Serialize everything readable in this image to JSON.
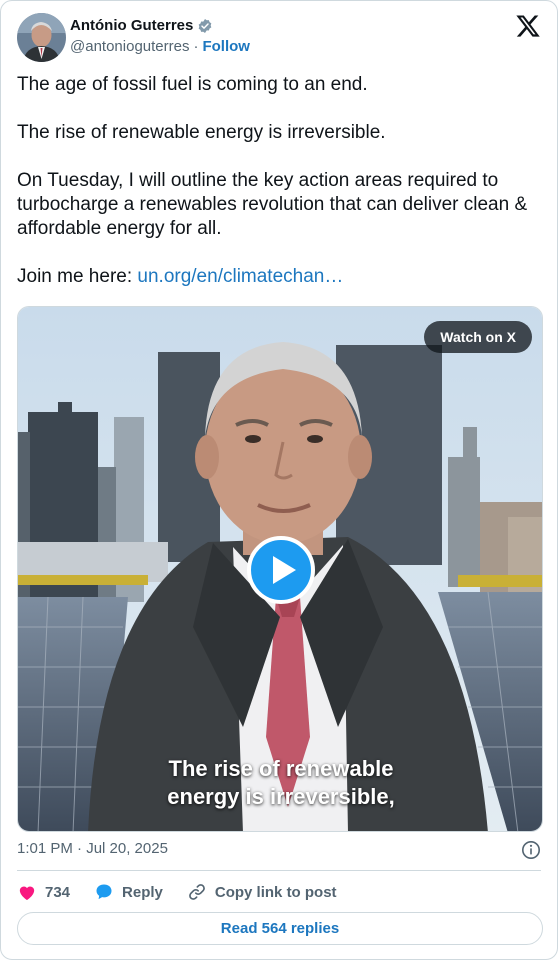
{
  "author": {
    "name": "António Guterres",
    "handle": "@antonioguterres",
    "separator": "·",
    "follow_label": "Follow",
    "verified_icon": "verified-badge-icon"
  },
  "header": {
    "logo_icon": "x-logo-icon"
  },
  "tweet": {
    "line1": "The age of fossil fuel is coming to an end.",
    "line2": "The rise of renewable energy is irreversible.",
    "line3": "On Tuesday, I will outline the key action areas required to turbocharge a renewables revolution that can deliver clean & affordable energy for all.",
    "join_prefix": "Join me here:",
    "link_text": "un.org/en/climatechan…"
  },
  "media": {
    "watch_label": "Watch on X",
    "play_icon": "play-icon",
    "caption_line1": "The rise of renewable",
    "caption_line2": "energy is irreversible,"
  },
  "meta": {
    "timestamp": "1:01 PM · Jul 20, 2025",
    "info_icon": "info-icon"
  },
  "actions": {
    "like_count": "734",
    "reply_label": "Reply",
    "copy_label": "Copy link to post",
    "read_replies_label": "Read 564 replies"
  },
  "colors": {
    "link": "#1d77bf",
    "like": "#f91880",
    "reply_bubble": "#1d9bf0",
    "secondary_text": "#536471",
    "border": "#cfd9de"
  }
}
